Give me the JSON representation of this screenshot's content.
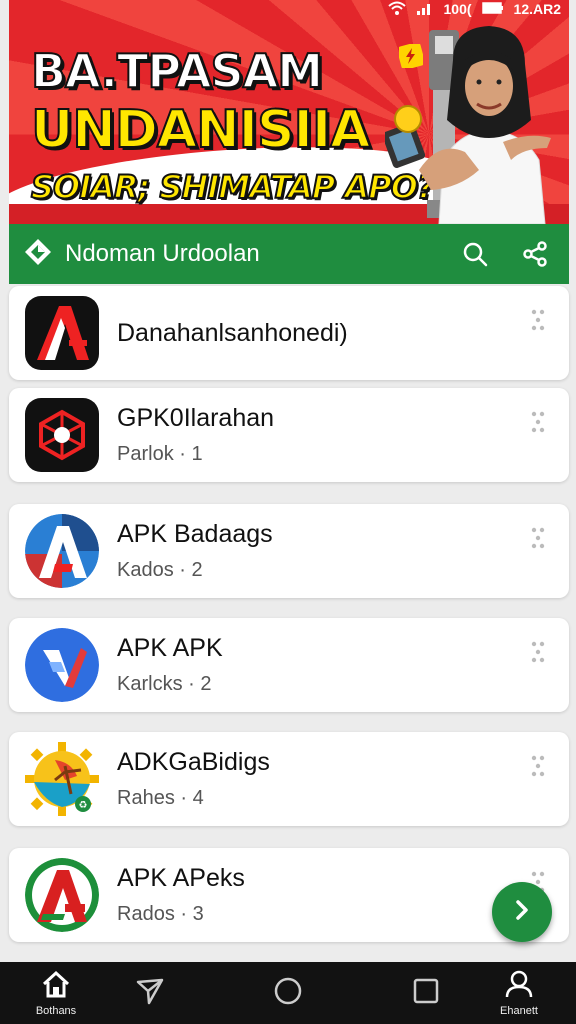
{
  "status_bar": {
    "signal": "100(",
    "time": "12.AR2"
  },
  "banner": {
    "line1": "BA.TPASAM",
    "line2": "UNDANISIIA",
    "line3": "SOIAR; SHIMATAP APO?"
  },
  "header": {
    "title": "Ndoman Urdoolan",
    "accent": "#1f8d3f"
  },
  "apps": [
    {
      "name": "Danahanlsanhonedi)",
      "sub": ""
    },
    {
      "name": "GPK0Ilarahan",
      "sub": "Parlok · 1"
    },
    {
      "name": "APK Badaags",
      "sub": "Kados · 2"
    },
    {
      "name": "APK APK",
      "sub": "Karlcks · 2"
    },
    {
      "name": "ADKGaBidigs",
      "sub": "Rahes · 4"
    },
    {
      "name": "APK APeks",
      "sub": "Rados · 3"
    }
  ],
  "nav": {
    "home_label": "Bothans",
    "profile_label": "Ehanett"
  }
}
